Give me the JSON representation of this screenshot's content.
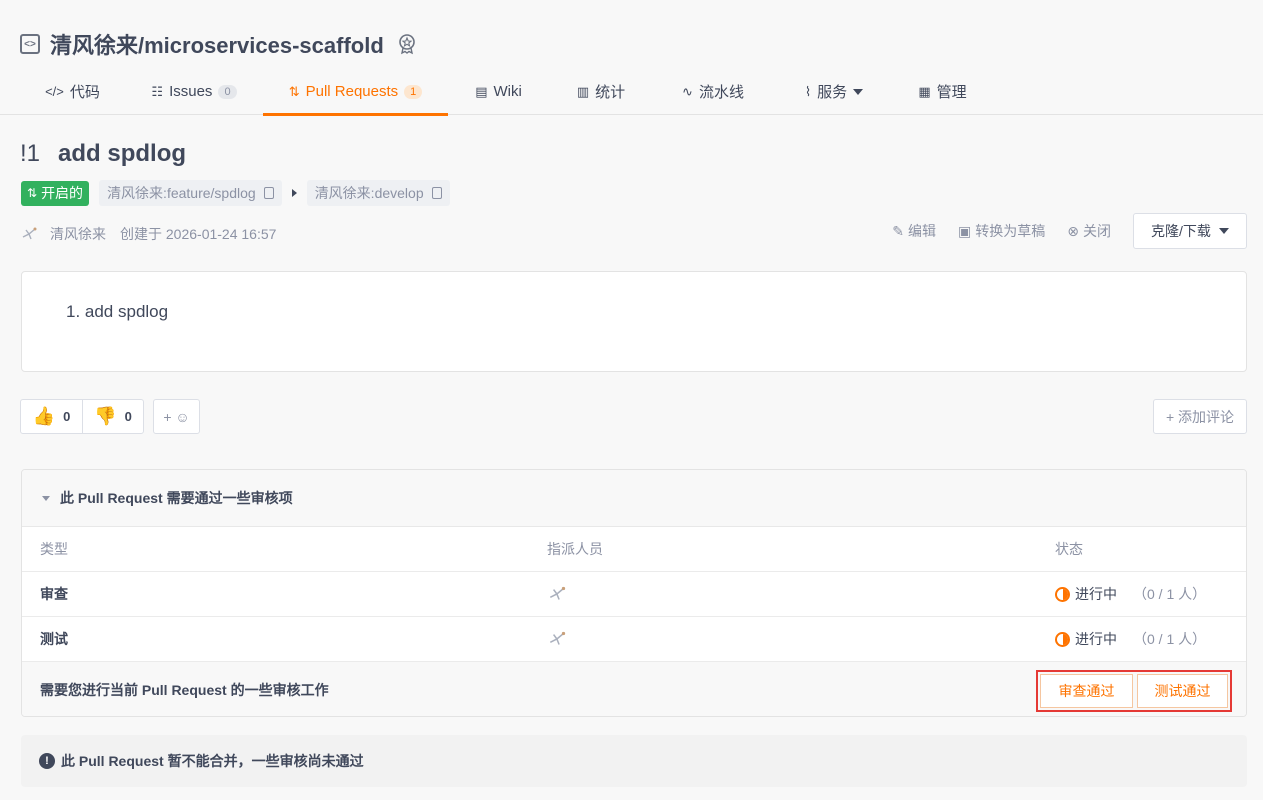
{
  "repo": {
    "name": "清风徐来/microservices-scaffold",
    "icon": "code-repo-icon",
    "badge_icon": "award-badge-icon"
  },
  "tabs": [
    {
      "label": "代码",
      "icon": "code-icon"
    },
    {
      "label": "Issues",
      "icon": "issues-icon",
      "count": "0"
    },
    {
      "label": "Pull Requests",
      "icon": "pull-request-icon",
      "count": "1",
      "active": true
    },
    {
      "label": "Wiki",
      "icon": "wiki-icon"
    },
    {
      "label": "统计",
      "icon": "stats-icon"
    },
    {
      "label": "流水线",
      "icon": "pipeline-icon"
    },
    {
      "label": "服务",
      "icon": "service-icon",
      "dropdown": true
    },
    {
      "label": "管理",
      "icon": "manage-icon"
    }
  ],
  "pr": {
    "number": "!1",
    "title": "add spdlog",
    "state": "开启的",
    "source_branch": "清风徐来:feature/spdlog",
    "target_branch": "清风徐来:develop",
    "author": "清风徐来",
    "created": "创建于 2026-01-24 16:57",
    "description_item": "1. add spdlog"
  },
  "actions": {
    "edit": "编辑",
    "draft": "转换为草稿",
    "close": "关闭",
    "clone": "克隆/下载"
  },
  "reactions": {
    "up": "0",
    "down": "0",
    "add": "+ ☺",
    "add_comment": "+ 添加评论"
  },
  "review": {
    "heading": "此 Pull Request 需要通过一些审核项",
    "columns": {
      "type": "类型",
      "assignee": "指派人员",
      "status": "状态"
    },
    "rows": [
      {
        "type": "审查",
        "status": "进行中",
        "count": "（0 / 1 人）"
      },
      {
        "type": "测试",
        "status": "进行中",
        "count": "（0 / 1 人）"
      }
    ],
    "footer": "需要您进行当前 Pull Request 的一些审核工作",
    "approve_review": "审查通过",
    "approve_test": "测试通过"
  },
  "merge_warning": "此 Pull Request 暂不能合并，一些审核尚未通过",
  "colors": {
    "accent": "#fe7300",
    "open": "#32b15e",
    "highlight": "#e53935"
  }
}
